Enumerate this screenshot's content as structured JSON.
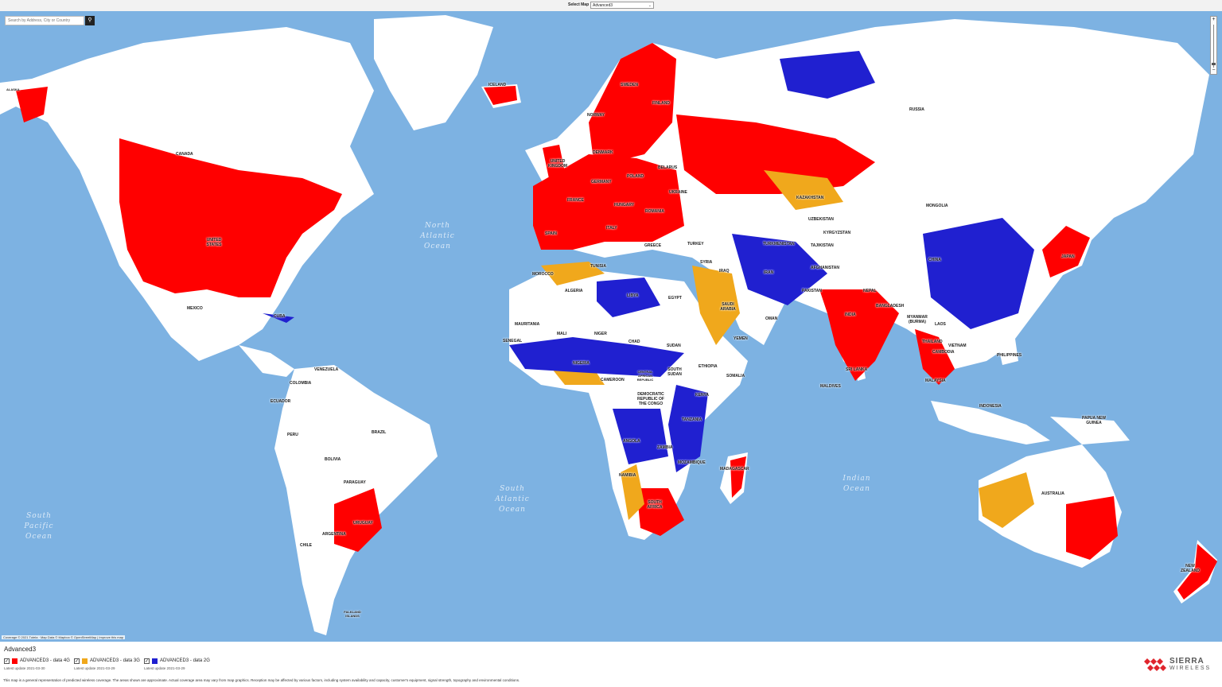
{
  "header": {
    "select_label": "Select Map",
    "selected_map": "Advanced3"
  },
  "search": {
    "placeholder": "Search by Address, City or Country"
  },
  "map": {
    "colors": {
      "ocean": "#7db2e2",
      "land": "#ffffff",
      "data_4g": "#ff0000",
      "data_3g": "#f0a81c",
      "data_2g": "#2020d0"
    },
    "country_labels": [
      "ICELAND",
      "SWEDEN",
      "FINLAND",
      "NORWAY",
      "RUSSIA",
      "CANADA",
      "UNITED KINGDOM",
      "DENMARK",
      "BELARUS",
      "POLAND",
      "GERMANY",
      "UKRAINE",
      "KAZAKHSTAN",
      "MONGOLIA",
      "FRANCE",
      "HUNGARY",
      "ROMANIA",
      "UNITED STATES",
      "SPAIN",
      "ITALY",
      "TURKEY",
      "GREECE",
      "UZBEKISTAN",
      "KYRGYZSTAN",
      "TURKMENISTAN",
      "TAJIKISTAN",
      "CHINA",
      "JAPAN",
      "SYRIA",
      "IRAQ",
      "IRAN",
      "AFGHANISTAN",
      "PAKISTAN",
      "NEPAL",
      "MOROCCO",
      "TUNISIA",
      "ALGERIA",
      "LIBYA",
      "EGYPT",
      "SAUDI ARABIA",
      "OMAN",
      "YEMEN",
      "MEXICO",
      "CUBA",
      "INDIA",
      "BANGLADESH",
      "MYANMAR (BURMA)",
      "LAOS",
      "THAILAND",
      "VIETNAM",
      "CAMBODIA",
      "PHILIPPINES",
      "MAURITANIA",
      "MALI",
      "NIGER",
      "CHAD",
      "SUDAN",
      "SENEGAL",
      "NIGERIA",
      "ETHIOPIA",
      "SOUTH SUDAN",
      "SOMALIA",
      "VENEZUELA",
      "COLOMBIA",
      "ECUADOR",
      "CAMEROON",
      "CENTRAL AFRICAN REPUBLIC",
      "DEMOCRATIC REPUBLIC OF THE CONGO",
      "KENYA",
      "TANZANIA",
      "SRI LANKA",
      "MALDIVES",
      "MALAYSIA",
      "INDONESIA",
      "PAPUA NEW GUINEA",
      "PERU",
      "BRAZIL",
      "BOLIVIA",
      "ANGOLA",
      "ZAMBIA",
      "MOZAMBIQUE",
      "NAMIBIA",
      "MADAGASCAR",
      "PARAGUAY",
      "SOUTH AFRICA",
      "AUSTRALIA",
      "CHILE",
      "URUGUAY",
      "ARGENTINA",
      "NEW ZEALAND",
      "ALASKA",
      "FALKLAND ISLANDS"
    ],
    "ocean_labels": [
      "North Atlantic Ocean",
      "South Atlantic Ocean",
      "Indian Ocean",
      "South Pacific Ocean"
    ]
  },
  "attribution": "Coverage © 2021 Tutela · Map Data © Mapbox © OpenStreetMap | Improve this map",
  "legend": {
    "title": "Advanced3",
    "items": [
      {
        "name": "ADVANCED3 - data 4G",
        "color": "#ff0000",
        "updated": "Latest update 2021-03-30",
        "checked": true
      },
      {
        "name": "ADVANCED3 - data 3G",
        "color": "#f0a81c",
        "updated": "Latest update 2021-03-29",
        "checked": true
      },
      {
        "name": "ADVANCED3 - data 2G",
        "color": "#2020d0",
        "updated": "Latest update 2021-03-29",
        "checked": true
      }
    ]
  },
  "logo": {
    "line1": "SIERRA",
    "line2": "WIRELESS"
  },
  "disclaimer": "This map is a general representation of predicted wireless coverage. The areas shown are approximate. Actual coverage area may vary from map graphics. Reception may be affected by various factors, including system availability and capacity, customer's equipment, signal strength, topography and environmental conditions."
}
